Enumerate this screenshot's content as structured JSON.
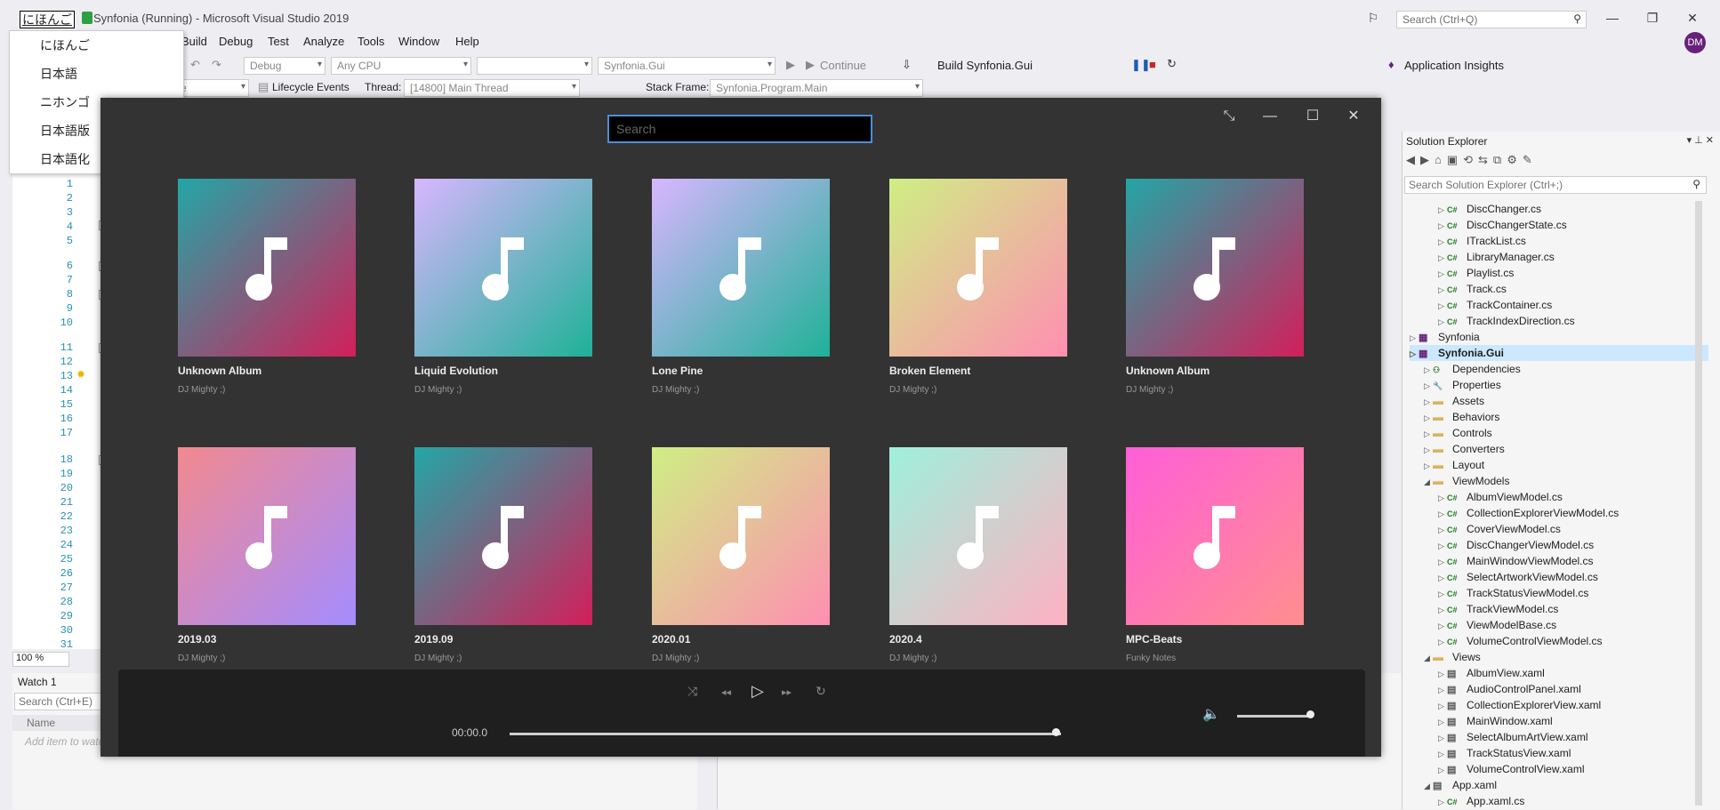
{
  "vs": {
    "title": "Synfonia (Running) - Microsoft Visual Studio 2019",
    "search_placeholder": "Search (Ctrl+Q)",
    "avatar_initials": "DM",
    "menu": [
      "Build",
      "Debug",
      "Test",
      "Analyze",
      "Tools",
      "Window",
      "Help"
    ],
    "toolbar": {
      "config": "Debug",
      "platform": "Any CPU",
      "startup_item": "",
      "project": "Synfonia.Gui",
      "continue": "Continue",
      "build": "Build Synfonia.Gui",
      "app_insights": "Application Insights"
    },
    "debug_bar": {
      "lifecycle": "Lifecycle Events",
      "thread_label": "Thread:",
      "thread_value": "[14800] Main Thread",
      "stack_label": "Stack Frame:",
      "stack_value": "Synfonia.Program.Main",
      "partial_left": "e"
    },
    "line_numbers": [
      "1",
      "2",
      "3",
      "4",
      "5",
      "6",
      "7",
      "8",
      "9",
      "10",
      "11",
      "12",
      "13",
      "14",
      "15",
      "16",
      "17",
      "18",
      "19",
      "20",
      "21",
      "22",
      "23",
      "24",
      "25",
      "26",
      "27",
      "28",
      "29",
      "30",
      "31"
    ],
    "zoom": "100 %",
    "watch": {
      "title": "Watch 1",
      "search_placeholder": "Search (Ctrl+E)",
      "col_name": "Name",
      "hint": "Add item to watch"
    }
  },
  "ime": {
    "composing": "にほんご",
    "candidates": [
      "にほんご",
      "日本語",
      "ニホンゴ",
      "日本語版",
      "日本語化"
    ]
  },
  "solution_explorer": {
    "title": "Solution Explorer",
    "search_placeholder": "Search Solution Explorer (Ctrl+;)",
    "items": [
      {
        "label": "DiscChanger.cs",
        "kind": "cs",
        "depth": 2
      },
      {
        "label": "DiscChangerState.cs",
        "kind": "cs",
        "depth": 2
      },
      {
        "label": "ITrackList.cs",
        "kind": "cs",
        "depth": 2
      },
      {
        "label": "LibraryManager.cs",
        "kind": "cs",
        "depth": 2
      },
      {
        "label": "Playlist.cs",
        "kind": "cs",
        "depth": 2
      },
      {
        "label": "Track.cs",
        "kind": "cs",
        "depth": 2
      },
      {
        "label": "TrackContainer.cs",
        "kind": "cs",
        "depth": 2
      },
      {
        "label": "TrackIndexDirection.cs",
        "kind": "cs",
        "depth": 2
      },
      {
        "label": "Synfonia",
        "kind": "proj",
        "depth": 0
      },
      {
        "label": "Synfonia.Gui",
        "kind": "proj",
        "depth": 0,
        "selected": true
      },
      {
        "label": "Dependencies",
        "kind": "deps",
        "depth": 1
      },
      {
        "label": "Properties",
        "kind": "wrench",
        "depth": 1
      },
      {
        "label": "Assets",
        "kind": "folder",
        "depth": 1
      },
      {
        "label": "Behaviors",
        "kind": "folder",
        "depth": 1
      },
      {
        "label": "Controls",
        "kind": "folder",
        "depth": 1
      },
      {
        "label": "Converters",
        "kind": "folder",
        "depth": 1
      },
      {
        "label": "Layout",
        "kind": "folder",
        "depth": 1
      },
      {
        "label": "ViewModels",
        "kind": "folder",
        "depth": 1,
        "open": true
      },
      {
        "label": "AlbumViewModel.cs",
        "kind": "cs",
        "depth": 2
      },
      {
        "label": "CollectionExplorerViewModel.cs",
        "kind": "cs",
        "depth": 2
      },
      {
        "label": "CoverViewModel.cs",
        "kind": "cs",
        "depth": 2
      },
      {
        "label": "DiscChangerViewModel.cs",
        "kind": "cs",
        "depth": 2
      },
      {
        "label": "MainWindowViewModel.cs",
        "kind": "cs",
        "depth": 2
      },
      {
        "label": "SelectArtworkViewModel.cs",
        "kind": "cs",
        "depth": 2
      },
      {
        "label": "TrackStatusViewModel.cs",
        "kind": "cs",
        "depth": 2
      },
      {
        "label": "TrackViewModel.cs",
        "kind": "cs",
        "depth": 2
      },
      {
        "label": "ViewModelBase.cs",
        "kind": "cs",
        "depth": 2
      },
      {
        "label": "VolumeControlViewModel.cs",
        "kind": "cs",
        "depth": 2
      },
      {
        "label": "Views",
        "kind": "folder",
        "depth": 1,
        "open": true
      },
      {
        "label": "AlbumView.xaml",
        "kind": "xaml",
        "depth": 2
      },
      {
        "label": "AudioControlPanel.xaml",
        "kind": "xaml",
        "depth": 2
      },
      {
        "label": "CollectionExplorerView.xaml",
        "kind": "xaml",
        "depth": 2
      },
      {
        "label": "MainWindow.xaml",
        "kind": "xaml",
        "depth": 2
      },
      {
        "label": "SelectAlbumArtView.xaml",
        "kind": "xaml",
        "depth": 2
      },
      {
        "label": "TrackStatusView.xaml",
        "kind": "xaml",
        "depth": 2
      },
      {
        "label": "VolumeControlView.xaml",
        "kind": "xaml",
        "depth": 2
      },
      {
        "label": "App.xaml",
        "kind": "xaml",
        "depth": 1,
        "open": true
      },
      {
        "label": "App.xaml.cs",
        "kind": "cs",
        "depth": 2
      }
    ]
  },
  "app": {
    "search_placeholder": "Search",
    "albums": [
      {
        "title": "Unknown Album",
        "artist": "DJ Mighty ;)",
        "gradient": [
          "#23a6a6",
          "#d21f5a"
        ]
      },
      {
        "title": "Liquid Evolution",
        "artist": "DJ Mighty ;)",
        "gradient": [
          "#d8b6ff",
          "#1fb197"
        ]
      },
      {
        "title": "Lone Pine",
        "artist": "DJ Mighty ;)",
        "gradient": [
          "#d8b6ff",
          "#1fb197"
        ]
      },
      {
        "title": "Broken Element",
        "artist": "DJ Mighty ;)",
        "gradient": [
          "#cfee84",
          "#ff8fb1"
        ]
      },
      {
        "title": "Unknown Album",
        "artist": "DJ Mighty ;)",
        "gradient": [
          "#23a6a6",
          "#d21f5a"
        ]
      },
      {
        "title": "2019.03",
        "artist": "DJ Mighty ;)",
        "gradient": [
          "#f2898f",
          "#a58cff"
        ]
      },
      {
        "title": "2019.09",
        "artist": "DJ Mighty ;)",
        "gradient": [
          "#23a6a6",
          "#d21f5a"
        ]
      },
      {
        "title": "2020.01",
        "artist": "DJ Mighty ;)",
        "gradient": [
          "#cfee84",
          "#ff8fb1"
        ]
      },
      {
        "title": "2020.4",
        "artist": "DJ Mighty ;)",
        "gradient": [
          "#9ff0dc",
          "#ffb1c2"
        ]
      },
      {
        "title": "MPC-Beats",
        "artist": "Funky Notes",
        "gradient": [
          "#ff5ed8",
          "#ff8f8f"
        ]
      }
    ],
    "player": {
      "time": "00:00.0",
      "progress": 0.99,
      "volume": 0.95
    }
  }
}
